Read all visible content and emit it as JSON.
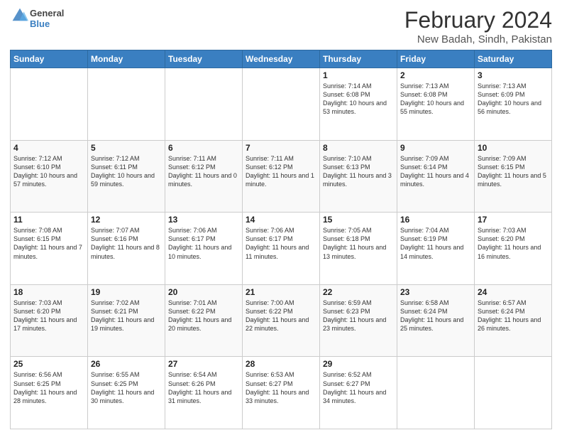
{
  "logo": {
    "text_general": "General",
    "text_blue": "Blue"
  },
  "header": {
    "title": "February 2024",
    "subtitle": "New Badah, Sindh, Pakistan"
  },
  "weekdays": [
    "Sunday",
    "Monday",
    "Tuesday",
    "Wednesday",
    "Thursday",
    "Friday",
    "Saturday"
  ],
  "weeks": [
    [
      {
        "day": "",
        "info": ""
      },
      {
        "day": "",
        "info": ""
      },
      {
        "day": "",
        "info": ""
      },
      {
        "day": "",
        "info": ""
      },
      {
        "day": "1",
        "info": "Sunrise: 7:14 AM\nSunset: 6:08 PM\nDaylight: 10 hours and 53 minutes."
      },
      {
        "day": "2",
        "info": "Sunrise: 7:13 AM\nSunset: 6:08 PM\nDaylight: 10 hours and 55 minutes."
      },
      {
        "day": "3",
        "info": "Sunrise: 7:13 AM\nSunset: 6:09 PM\nDaylight: 10 hours and 56 minutes."
      }
    ],
    [
      {
        "day": "4",
        "info": "Sunrise: 7:12 AM\nSunset: 6:10 PM\nDaylight: 10 hours and 57 minutes."
      },
      {
        "day": "5",
        "info": "Sunrise: 7:12 AM\nSunset: 6:11 PM\nDaylight: 10 hours and 59 minutes."
      },
      {
        "day": "6",
        "info": "Sunrise: 7:11 AM\nSunset: 6:12 PM\nDaylight: 11 hours and 0 minutes."
      },
      {
        "day": "7",
        "info": "Sunrise: 7:11 AM\nSunset: 6:12 PM\nDaylight: 11 hours and 1 minute."
      },
      {
        "day": "8",
        "info": "Sunrise: 7:10 AM\nSunset: 6:13 PM\nDaylight: 11 hours and 3 minutes."
      },
      {
        "day": "9",
        "info": "Sunrise: 7:09 AM\nSunset: 6:14 PM\nDaylight: 11 hours and 4 minutes."
      },
      {
        "day": "10",
        "info": "Sunrise: 7:09 AM\nSunset: 6:15 PM\nDaylight: 11 hours and 5 minutes."
      }
    ],
    [
      {
        "day": "11",
        "info": "Sunrise: 7:08 AM\nSunset: 6:15 PM\nDaylight: 11 hours and 7 minutes."
      },
      {
        "day": "12",
        "info": "Sunrise: 7:07 AM\nSunset: 6:16 PM\nDaylight: 11 hours and 8 minutes."
      },
      {
        "day": "13",
        "info": "Sunrise: 7:06 AM\nSunset: 6:17 PM\nDaylight: 11 hours and 10 minutes."
      },
      {
        "day": "14",
        "info": "Sunrise: 7:06 AM\nSunset: 6:17 PM\nDaylight: 11 hours and 11 minutes."
      },
      {
        "day": "15",
        "info": "Sunrise: 7:05 AM\nSunset: 6:18 PM\nDaylight: 11 hours and 13 minutes."
      },
      {
        "day": "16",
        "info": "Sunrise: 7:04 AM\nSunset: 6:19 PM\nDaylight: 11 hours and 14 minutes."
      },
      {
        "day": "17",
        "info": "Sunrise: 7:03 AM\nSunset: 6:20 PM\nDaylight: 11 hours and 16 minutes."
      }
    ],
    [
      {
        "day": "18",
        "info": "Sunrise: 7:03 AM\nSunset: 6:20 PM\nDaylight: 11 hours and 17 minutes."
      },
      {
        "day": "19",
        "info": "Sunrise: 7:02 AM\nSunset: 6:21 PM\nDaylight: 11 hours and 19 minutes."
      },
      {
        "day": "20",
        "info": "Sunrise: 7:01 AM\nSunset: 6:22 PM\nDaylight: 11 hours and 20 minutes."
      },
      {
        "day": "21",
        "info": "Sunrise: 7:00 AM\nSunset: 6:22 PM\nDaylight: 11 hours and 22 minutes."
      },
      {
        "day": "22",
        "info": "Sunrise: 6:59 AM\nSunset: 6:23 PM\nDaylight: 11 hours and 23 minutes."
      },
      {
        "day": "23",
        "info": "Sunrise: 6:58 AM\nSunset: 6:24 PM\nDaylight: 11 hours and 25 minutes."
      },
      {
        "day": "24",
        "info": "Sunrise: 6:57 AM\nSunset: 6:24 PM\nDaylight: 11 hours and 26 minutes."
      }
    ],
    [
      {
        "day": "25",
        "info": "Sunrise: 6:56 AM\nSunset: 6:25 PM\nDaylight: 11 hours and 28 minutes."
      },
      {
        "day": "26",
        "info": "Sunrise: 6:55 AM\nSunset: 6:25 PM\nDaylight: 11 hours and 30 minutes."
      },
      {
        "day": "27",
        "info": "Sunrise: 6:54 AM\nSunset: 6:26 PM\nDaylight: 11 hours and 31 minutes."
      },
      {
        "day": "28",
        "info": "Sunrise: 6:53 AM\nSunset: 6:27 PM\nDaylight: 11 hours and 33 minutes."
      },
      {
        "day": "29",
        "info": "Sunrise: 6:52 AM\nSunset: 6:27 PM\nDaylight: 11 hours and 34 minutes."
      },
      {
        "day": "",
        "info": ""
      },
      {
        "day": "",
        "info": ""
      }
    ]
  ]
}
